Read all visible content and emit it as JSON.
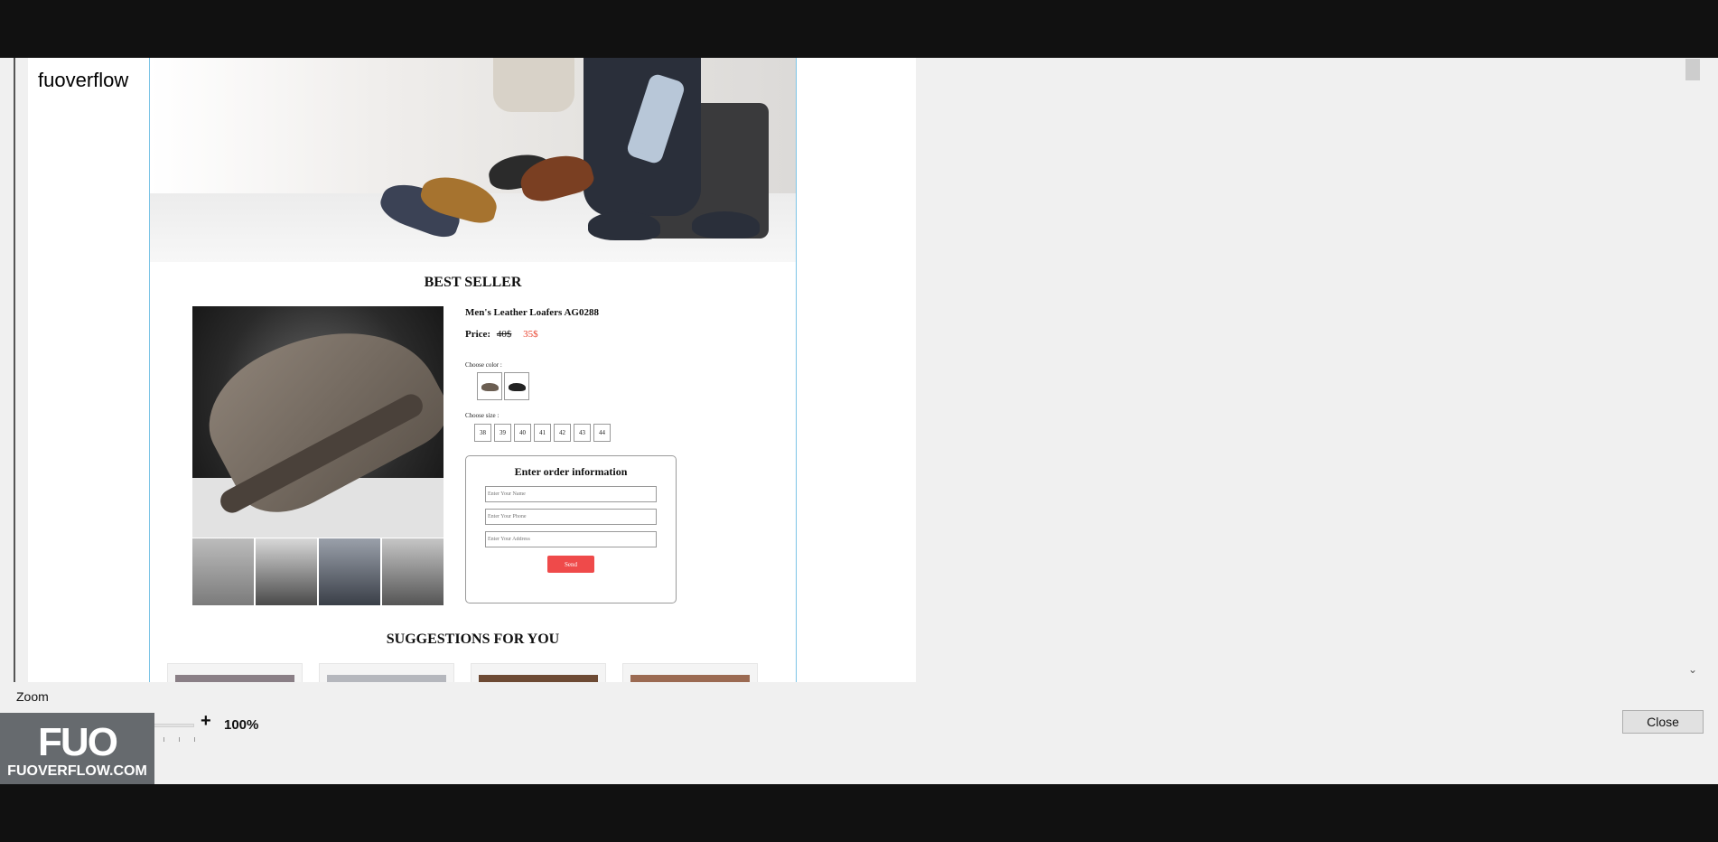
{
  "site": {
    "label": "fuoverflow"
  },
  "email": {
    "best_seller_heading": "BEST SELLER",
    "product": {
      "title": "Men's Leather Loafers AG0288",
      "price_label": "Price:",
      "old_price": "40$",
      "new_price": "35$",
      "choose_color_label": "Choose color :",
      "colors": [
        "#6b5e52",
        "#222222"
      ],
      "choose_size_label": "Choose size :",
      "sizes": [
        "38",
        "39",
        "40",
        "41",
        "42",
        "43",
        "44"
      ]
    },
    "order": {
      "title": "Enter order information",
      "name_placeholder": "Enter Your Name",
      "phone_placeholder": "Enter Your Phone",
      "address_placeholder": "Enter Your Address",
      "send_label": "Send"
    },
    "suggestions_heading": "SUGGESTIONS FOR YOU"
  },
  "zoom": {
    "label": "Zoom",
    "minus": "-",
    "plus": "+",
    "value_text": "100%",
    "level_fraction": 0.5
  },
  "dialog": {
    "close_label": "Close"
  },
  "watermark": {
    "mark": "FUO",
    "text": "FUOVERFLOW.COM"
  },
  "colors": {
    "accent": "#1565c0",
    "send_button": "#ef4a4a",
    "sale_price": "#e8412c",
    "email_border": "#7cc4e6"
  }
}
